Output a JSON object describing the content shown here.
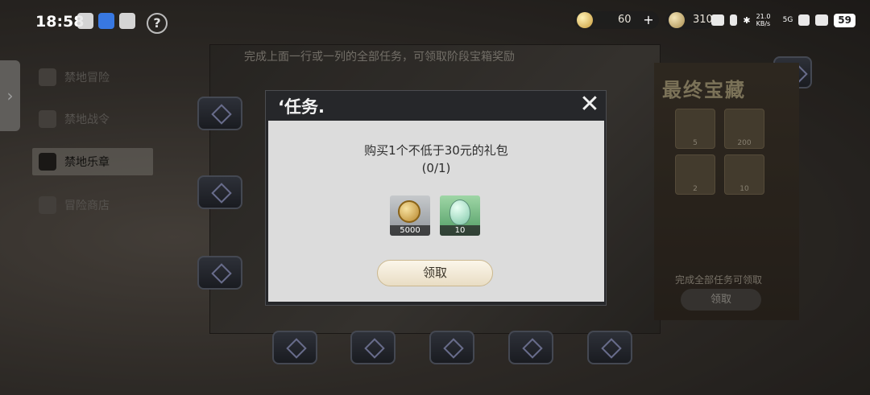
{
  "status_bar": {
    "time": "18:58",
    "network_speed": "21.0 KB/s",
    "network_type": "5G",
    "battery": "59"
  },
  "resources": [
    {
      "icon": "coin-icon",
      "value": "60"
    },
    {
      "icon": "energy-icon",
      "value": "310"
    }
  ],
  "page_hint": "完成上面一行或一列的全部任务，可领取阶段宝箱奖励",
  "nav": {
    "items": [
      {
        "label": "禁地冒险",
        "active": false
      },
      {
        "label": "禁地战令",
        "active": false
      },
      {
        "label": "禁地乐章",
        "active": true
      },
      {
        "label": "冒险商店",
        "active": false
      }
    ]
  },
  "treasure": {
    "title": "最终宝藏",
    "items": [
      {
        "icon": "dice-icon",
        "qty": "5"
      },
      {
        "icon": "egg-icon",
        "qty": "200"
      },
      {
        "icon": "gem-icon",
        "qty": "2"
      },
      {
        "icon": "crystal-icon",
        "qty": "10"
      }
    ],
    "note": "完成全部任务可领取",
    "claim_label": "领取"
  },
  "modal": {
    "title": "‘任务.",
    "task_description": "购买1个不低于30元的礼包",
    "progress": "(0/1)",
    "rewards": [
      {
        "icon": "gold-coin-icon",
        "qty": "5000"
      },
      {
        "icon": "green-egg-icon",
        "qty": "10"
      }
    ],
    "claim_label": "领取"
  }
}
